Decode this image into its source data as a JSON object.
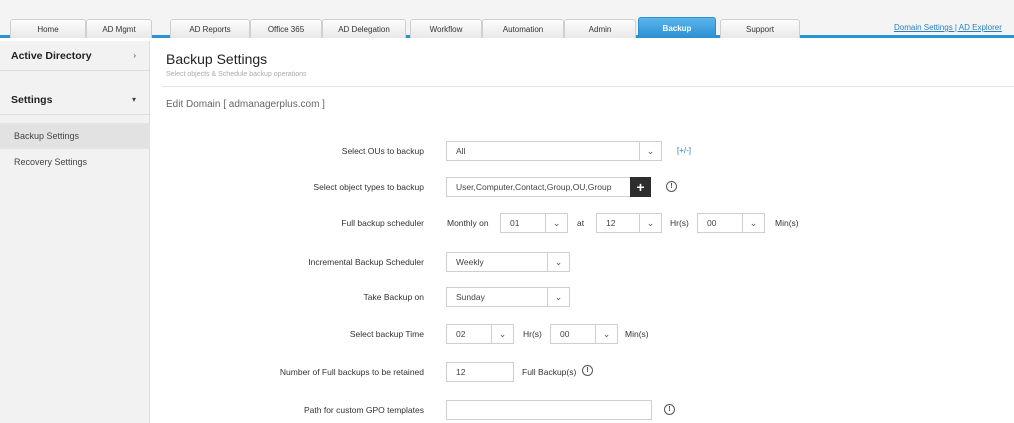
{
  "top_tabs": [
    "Home",
    "AD Mgmt",
    "AD Reports",
    "Office 365",
    "AD Delegation",
    "Workflow",
    "Automation",
    "Admin",
    "Backup",
    "Support"
  ],
  "active_tab": "Backup",
  "top_links": "Domain Settings | AD Explorer",
  "sidebar": {
    "sections": [
      {
        "label": "Active Directory",
        "chevron": "›"
      },
      {
        "label": "Settings",
        "chevron": "▾"
      }
    ],
    "items": [
      "Backup Settings",
      "Recovery Settings"
    ]
  },
  "page": {
    "title": "Backup Settings",
    "subtitle": "Select objects & Schedule backup operations",
    "edit_domain": "Edit Domain [ admanagerplus.com ]"
  },
  "form": {
    "select_ous": {
      "label": "Select OUs to backup",
      "value": "All",
      "toggle": "[+/-]"
    },
    "object_types": {
      "label": "Select object types to backup",
      "value": "User,Computer,Contact,Group,OU,Group"
    },
    "full_scheduler": {
      "label": "Full backup scheduler",
      "prefix": "Monthly on",
      "day": "01",
      "at": "at",
      "hour": "12",
      "hr_label": "Hr(s)",
      "minute": "00",
      "min_label": "Min(s)"
    },
    "incremental": {
      "label": "Incremental Backup Scheduler",
      "value": "Weekly"
    },
    "take_backup_on": {
      "label": "Take Backup on",
      "value": "Sunday"
    },
    "backup_time": {
      "label": "Select backup Time",
      "hour": "02",
      "hr_label": "Hr(s)",
      "minute": "00",
      "min_label": "Min(s)"
    },
    "retained": {
      "label": "Number of Full backups to be retained",
      "value": "12",
      "suffix": "Full Backup(s)"
    },
    "gpo_path": {
      "label": "Path for custom GPO templates",
      "value": ""
    }
  },
  "icons": {
    "info": "info-icon",
    "dropdown": "chevron-down-icon",
    "add": "plus-icon"
  }
}
